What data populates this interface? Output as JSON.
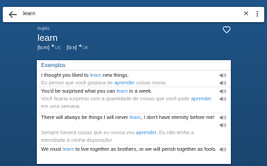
{
  "search": {
    "query": "learn"
  },
  "entry": {
    "language": "Inglês",
    "word": "learn",
    "pronunciations": [
      {
        "ipa": "[lɜːrn]",
        "region": "US"
      },
      {
        "ipa": "[lɜːn]",
        "region": "UK"
      }
    ]
  },
  "examples": {
    "title": "Exemplos",
    "items": [
      {
        "en": [
          {
            "t": "I thought you liked to "
          },
          {
            "t": "learn",
            "h": true
          },
          {
            "t": " new things."
          }
        ],
        "pt": [
          {
            "t": "Eu pensei que você gostava de "
          },
          {
            "t": "aprender",
            "h": true
          },
          {
            "t": " coisas novas."
          }
        ]
      },
      {
        "en": [
          {
            "t": "You'd be surprised what you can "
          },
          {
            "t": "learn",
            "h": true
          },
          {
            "t": " in a week."
          }
        ],
        "pt": [
          {
            "t": "Você ficaria surpreso com a quantidade de coisas que você pode "
          },
          {
            "t": "aprender",
            "h": true
          },
          {
            "t": " em uma semana."
          }
        ]
      },
      {
        "en": [
          {
            "t": "There will always be things I will never "
          },
          {
            "t": "learn",
            "h": true
          },
          {
            "t": ", I don't have eternity before me!"
          }
        ],
        "pt": [
          {
            "t": "Sempre haverá coisas que eu nunca vou "
          },
          {
            "t": "aprender",
            "h": true
          },
          {
            "t": ". Eu não tenho a eternidade à minha disposição!"
          }
        ]
      },
      {
        "en": [
          {
            "t": "We must "
          },
          {
            "t": "learn",
            "h": true
          },
          {
            "t": " to live together as brothers, or we will perish together as fools."
          }
        ],
        "pt": []
      }
    ]
  },
  "colors": {
    "header": "#1e5488",
    "highlight": "#3d8fd6",
    "accent": "#1c5a96"
  }
}
